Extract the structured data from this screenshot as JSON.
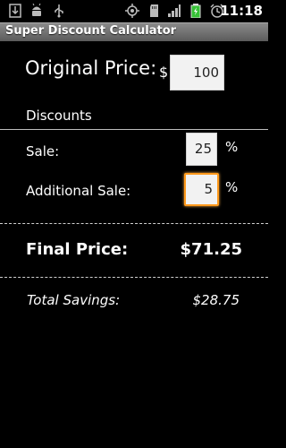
{
  "status_bar": {
    "time": "11:18",
    "icons": [
      "download-icon",
      "android-debug-icon",
      "usb-icon",
      "gps-icon",
      "sd-card-icon",
      "signal-icon",
      "battery-charging-icon",
      "alarm-icon"
    ]
  },
  "app": {
    "title": "Super Discount Calculator"
  },
  "original_price": {
    "label": "Original Price:",
    "currency": "$",
    "value": "100"
  },
  "discounts": {
    "heading": "Discounts",
    "sale": {
      "label": "Sale:",
      "value": "25",
      "unit": "%"
    },
    "additional_sale": {
      "label": "Additional Sale:",
      "value": "5",
      "unit": "%"
    }
  },
  "final_price": {
    "label": "Final Price:",
    "value": "$71.25"
  },
  "total_savings": {
    "label": "Total Savings:",
    "value": "$28.75"
  },
  "colors": {
    "background": "#000000",
    "focus": "#ff9a1c",
    "battery": "#36c236"
  }
}
